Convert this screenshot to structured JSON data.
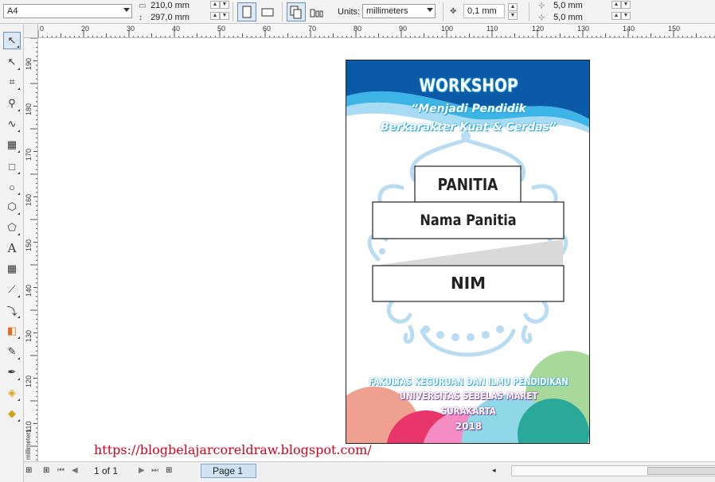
{
  "propbar": {
    "paper_size": "A4",
    "width_value": "210,0 mm",
    "height_value": "297,0 mm",
    "units_label": "Units:",
    "units_value": "millimeters",
    "nudge_value": "0,1 mm",
    "dup_x_value": "5,0 mm",
    "dup_y_value": "5,0 mm"
  },
  "rulers": {
    "horizontal": [
      "0",
      "20",
      "30",
      "40",
      "50",
      "60",
      "70",
      "80",
      "90",
      "100",
      "110",
      "120",
      "130",
      "140",
      "150"
    ],
    "vertical": [
      "190",
      "180",
      "170",
      "160",
      "150",
      "140",
      "130",
      "120",
      "110"
    ],
    "unit_label": "millimeters"
  },
  "card": {
    "title": "WORKSHOP",
    "subtitle_line1": "“Menjadi Pendidik",
    "subtitle_line2": "Berkarakter Kuat & Cerdas”",
    "label_panitia": "PANITIA",
    "label_nama": "Nama Panitia",
    "label_nim": "NIM",
    "footer_line1": "FAKULTAS KEGURUAN DAN ILMU PENDIDIKAN",
    "footer_line2": "UNIVERSITAS SEBELAS MARET",
    "footer_line3": "SURAKARTA",
    "footer_line4": "2018"
  },
  "watermark": "https://blogbelajarcoreldraw.blogspot.com/",
  "statusbar": {
    "page_count": "1 of 1",
    "page_tab": "Page 1"
  },
  "colors": {
    "blue_dark": "#0a5aa8",
    "blue_light": "#1aa0dc",
    "ornament": "#b9dcf3",
    "watermark": "#d6001c"
  }
}
